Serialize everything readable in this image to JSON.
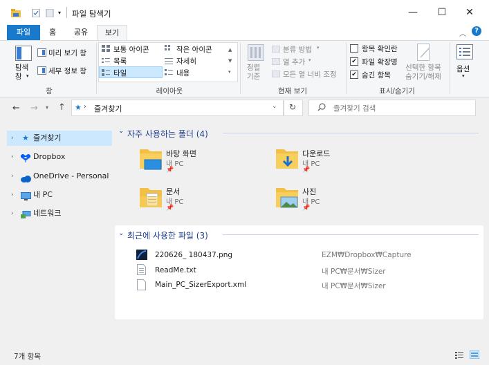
{
  "window": {
    "title": "파일 탐색기"
  },
  "tabs": {
    "file": "파일",
    "home": "홈",
    "share": "공유",
    "view": "보기"
  },
  "ribbon": {
    "nav_pane": "탐색\n창",
    "preview_pane": "미리 보기 창",
    "details_pane": "세부 정보 창",
    "pane_group": "창",
    "layouts": [
      "보통 아이콘",
      "작은 아이콘",
      "목록",
      "자세히",
      "타일",
      "내용"
    ],
    "layout_group": "레이아웃",
    "sort_by": "정렬\n기준",
    "group_by": "분류 방법",
    "add_columns": "열 추가",
    "fit_columns": "모든 열 너비 조정",
    "current_view_group": "현재 보기",
    "item_checkboxes": "항목 확인란",
    "file_extensions": "파일 확장명",
    "hidden_items": "숨긴 항목",
    "hide_selected": "선택한 항목\n숨기기/해제",
    "showhide_group": "표시/숨기기",
    "options": "옵션"
  },
  "address": {
    "current": "즐겨찾기",
    "search_placeholder": "즐겨찾기 검색"
  },
  "nav": {
    "items": [
      {
        "label": "즐겨찾기"
      },
      {
        "label": "Dropbox"
      },
      {
        "label": "OneDrive - Personal"
      },
      {
        "label": "내 PC"
      },
      {
        "label": "네트워크"
      }
    ]
  },
  "frequent": {
    "title": "자주 사용하는 폴더 (4)",
    "folders": [
      {
        "name": "바탕 화면",
        "location": "내 PC"
      },
      {
        "name": "다운로드",
        "location": "내 PC"
      },
      {
        "name": "문서",
        "location": "내 PC"
      },
      {
        "name": "사진",
        "location": "내 PC"
      }
    ]
  },
  "recent": {
    "title": "최근에 사용한 파일 (3)",
    "files": [
      {
        "name": "220626_ 180437.png",
        "path": "EZM₩Dropbox₩Capture"
      },
      {
        "name": "ReadMe.txt",
        "path": "내 PC₩문서₩Sizer"
      },
      {
        "name": "Main_PC_SizerExport.xml",
        "path": "내 PC₩문서₩Sizer"
      }
    ]
  },
  "status": {
    "count": "7개 항목"
  },
  "colors": {
    "accent": "#1979ca",
    "selected": "#cce8ff",
    "heading": "#1e3d8f"
  }
}
